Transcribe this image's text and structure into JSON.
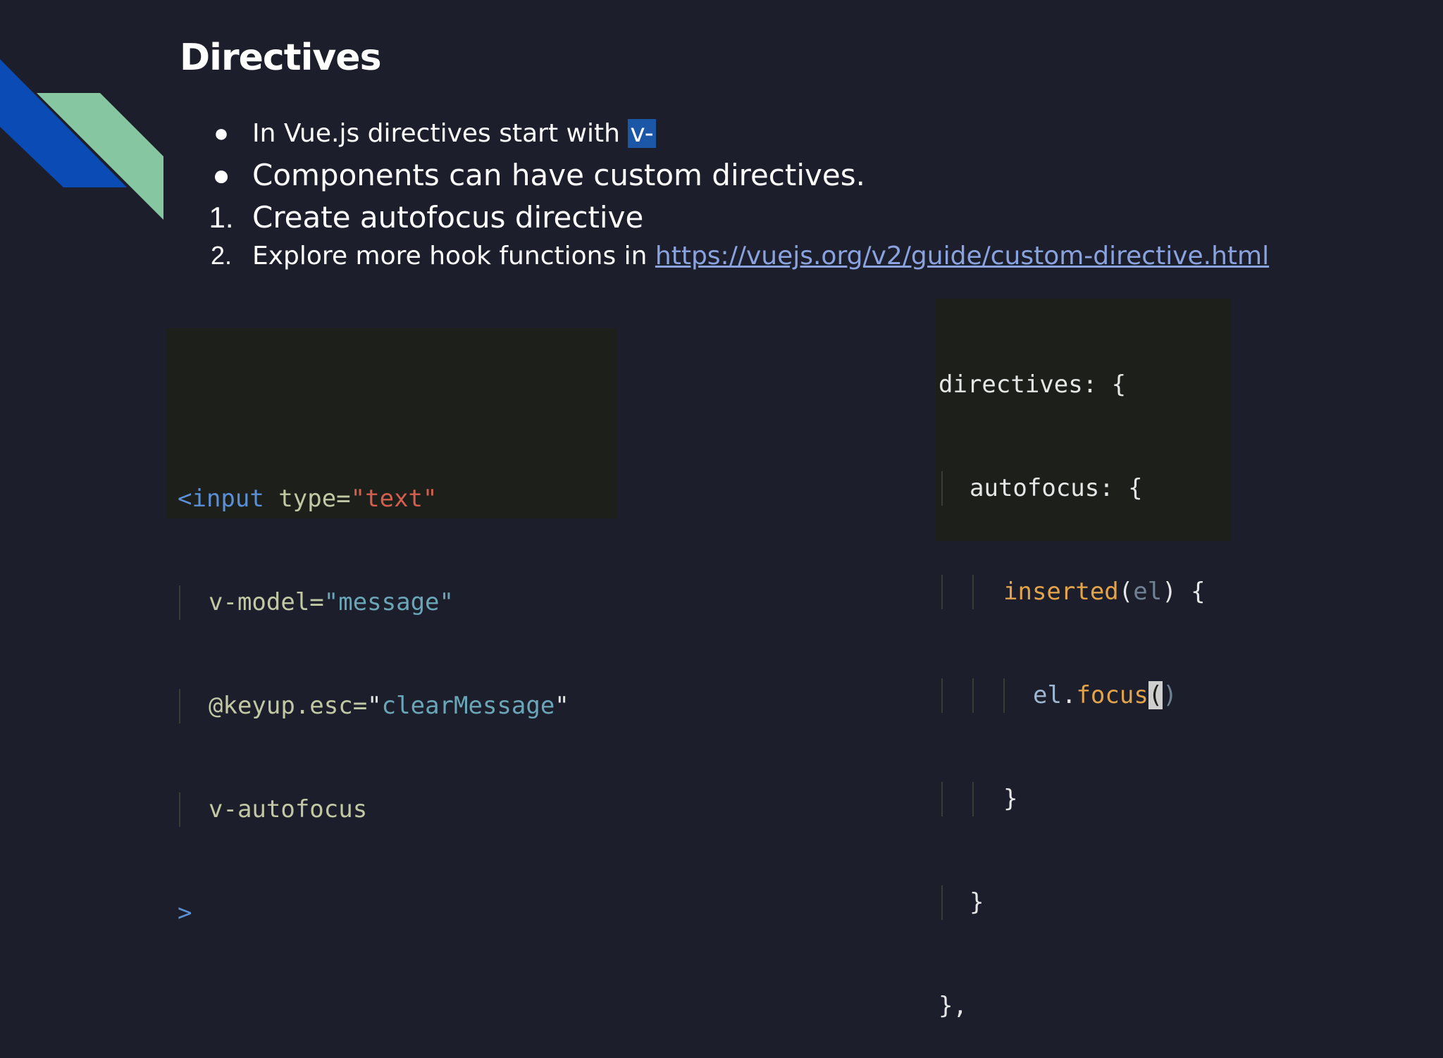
{
  "slide": {
    "title": "Directives",
    "bullets": [
      {
        "marker": "●",
        "text": "In Vue.js directives start with ",
        "highlight": "v-"
      },
      {
        "marker": "●",
        "text": "Components can have custom directives."
      },
      {
        "marker": "1.",
        "text": "Create autofocus directive"
      },
      {
        "marker": "2.",
        "text": "Explore more hook functions in ",
        "link": "https://vuejs.org/v2/guide/custom-directive.html"
      }
    ]
  },
  "code_left": {
    "line1": {
      "tag": "<input",
      "attr": " type=",
      "value": "\"text\""
    },
    "line2": {
      "attr": "v-model=",
      "value": "\"message\""
    },
    "line3": {
      "event": "@keyup.esc=",
      "q1": "\"",
      "value": "clearMessage",
      "q2": "\""
    },
    "line4": {
      "attr": "v-autofocus"
    },
    "line5": {
      "close": ">"
    }
  },
  "code_right": {
    "line1": "directives: {",
    "line2": "autofocus: {",
    "line3": {
      "fn": "inserted",
      "p1": "(",
      "arg": "el",
      "p2": ") {"
    },
    "line4": {
      "obj": "el",
      "dot": ".",
      "method": "focus",
      "open": "(",
      "close": ")"
    },
    "line5": "}",
    "line6": "}",
    "line7": "},"
  },
  "colors": {
    "background": "#1c1f2b",
    "accent_blue": "#0a4bb5",
    "accent_green": "#86c6a0",
    "highlight": "#1b57a6",
    "link": "#8aa2dd"
  }
}
